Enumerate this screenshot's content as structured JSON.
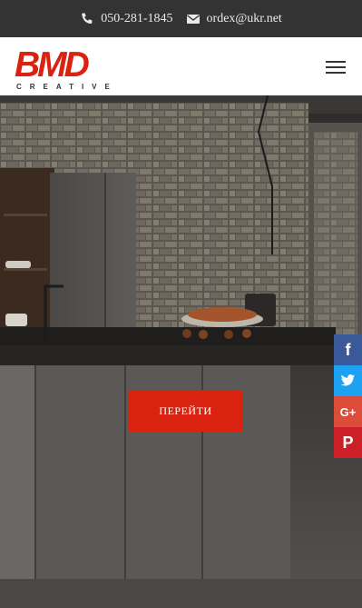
{
  "topbar": {
    "phone_icon": "phone-icon",
    "phone": "050-281-1845",
    "email_icon": "envelope-icon",
    "email": "ordex@ukr.net"
  },
  "header": {
    "logo_text": "BMD",
    "logo_subtext": "CREATIVE",
    "menu_icon": "hamburger-menu-icon"
  },
  "hero": {
    "cta_label": "ПЕРЕЙТИ"
  },
  "social": {
    "facebook_glyph": "f",
    "twitter_icon": "twitter-icon",
    "googleplus_glyph": "G+",
    "pinterest_glyph": "P"
  },
  "colors": {
    "accent": "#d9220f",
    "topbar_bg": "#333333",
    "facebook": "#3b5998",
    "twitter": "#1da1f2",
    "googleplus": "#dd4b39",
    "pinterest": "#cb2027"
  }
}
